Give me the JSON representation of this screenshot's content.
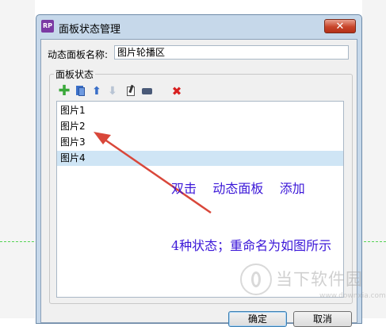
{
  "dialog": {
    "title": "面板状态管理",
    "app_icon_text": "RP",
    "close_symbol": "✕",
    "name_label": "动态面板名称:",
    "name_value": "图片轮播区",
    "group_label": "面板状态",
    "toolbar": {
      "add": "✚",
      "duplicate": "duplicate-icon",
      "move_up": "⬆",
      "move_down": "⬇",
      "edit": "edit-icon",
      "move_to": "move-icon",
      "delete": "✖"
    },
    "states": [
      "图片1",
      "图片2",
      "图片3",
      "图片4"
    ],
    "selected_state": "图片4",
    "ok_label": "确定",
    "cancel_label": "取消"
  },
  "annotation": {
    "line1": "双击    动态面板    添加",
    "line2": "4种状态；重命名为如图所示",
    "color": "#3b17d8",
    "arrow_color": "#d9473a"
  },
  "watermark": {
    "title": "当下软件园",
    "url": "www.downxia.com"
  }
}
